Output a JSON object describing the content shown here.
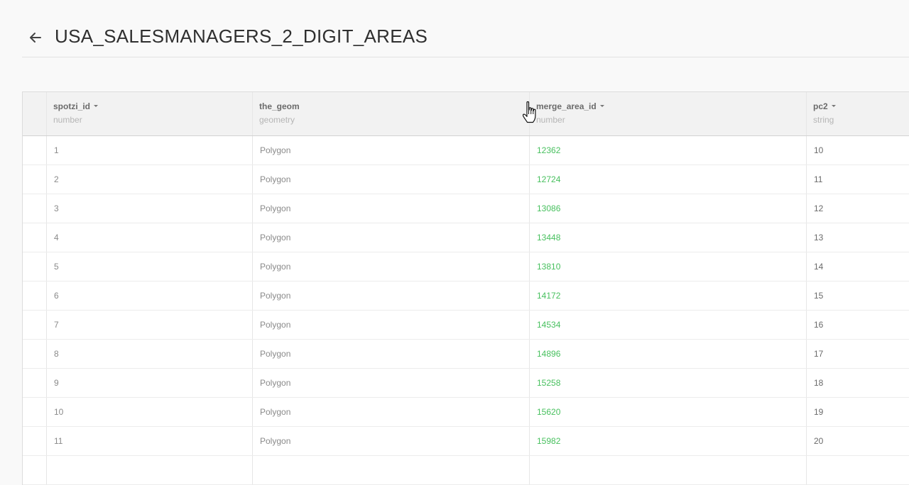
{
  "header": {
    "title": "USA_SALESMANAGERS_2_DIGIT_AREAS",
    "back_icon": "arrow-left-icon"
  },
  "table": {
    "columns": [
      {
        "name": "spotzi_id",
        "type": "number",
        "sortable": true
      },
      {
        "name": "the_geom",
        "type": "geometry",
        "sortable": false
      },
      {
        "name": "merge_area_id",
        "type": "number",
        "sortable": true
      },
      {
        "name": "pc2",
        "type": "string",
        "sortable": true
      }
    ],
    "rows": [
      [
        "1",
        "Polygon",
        "12362",
        "10"
      ],
      [
        "2",
        "Polygon",
        "12724",
        "11"
      ],
      [
        "3",
        "Polygon",
        "13086",
        "12"
      ],
      [
        "4",
        "Polygon",
        "13448",
        "13"
      ],
      [
        "5",
        "Polygon",
        "13810",
        "14"
      ],
      [
        "6",
        "Polygon",
        "14172",
        "15"
      ],
      [
        "7",
        "Polygon",
        "14534",
        "16"
      ],
      [
        "8",
        "Polygon",
        "14896",
        "17"
      ],
      [
        "9",
        "Polygon",
        "15258",
        "18"
      ],
      [
        "10",
        "Polygon",
        "15620",
        "19"
      ],
      [
        "11",
        "Polygon",
        "15982",
        "20"
      ],
      [
        "",
        "",
        "",
        ""
      ]
    ]
  },
  "colors": {
    "highlight_number": "#47c05e",
    "title_text": "#2f2f2f"
  },
  "cursor_icon": "hand-pointer-icon"
}
